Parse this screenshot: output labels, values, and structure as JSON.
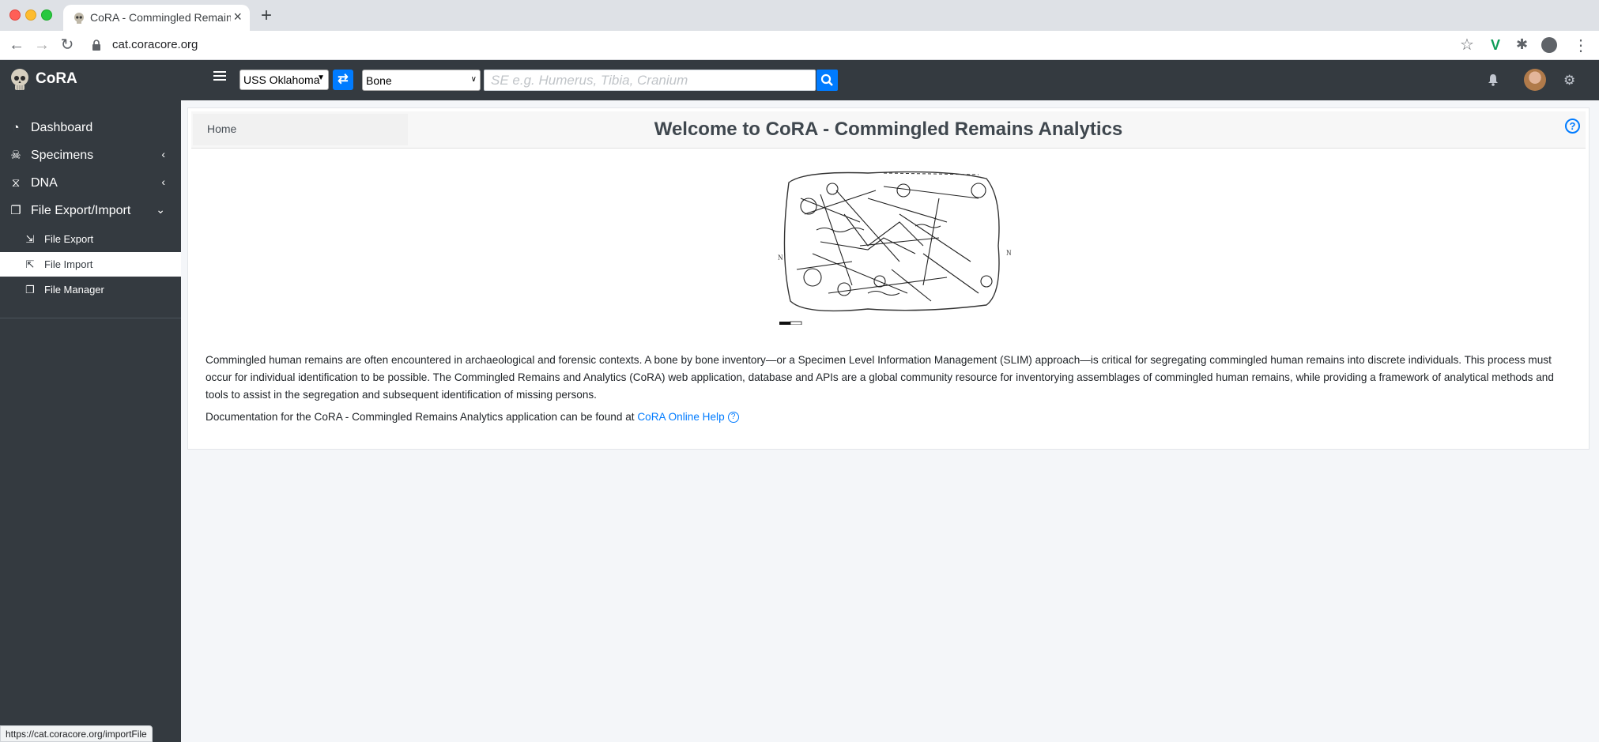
{
  "browser": {
    "tab_title": "CoRA - Commingled Remains /",
    "url": "cat.coracore.org",
    "status_url": "https://cat.coracore.org/importFile"
  },
  "navbar": {
    "brand": "CoRA",
    "project_select": "USS Oklahoma",
    "bone_select": "Bone",
    "search_placeholder": "SE e.g. Humerus, Tibia, Cranium"
  },
  "sidebar": {
    "items": [
      {
        "label": "Dashboard",
        "icon": "tachometer-icon"
      },
      {
        "label": "Specimens",
        "icon": "skull-icon"
      },
      {
        "label": "DNA",
        "icon": "dna-icon"
      },
      {
        "label": "File Export/Import",
        "icon": "copy-icon"
      }
    ],
    "subitems": [
      {
        "label": "File Export",
        "icon": "file-export-icon"
      },
      {
        "label": "File Import",
        "icon": "file-import-icon",
        "active": true
      },
      {
        "label": "File Manager",
        "icon": "copy-icon"
      }
    ]
  },
  "main": {
    "breadcrumb": "Home",
    "title": "Welcome to CoRA - Commingled Remains Analytics",
    "paragraph1": "Commingled human remains are often encountered in archaeological and forensic contexts. A bone by bone inventory—or a Specimen Level Information Management (SLIM) approach—is critical for segregating commingled human remains into discrete individuals. This process must occur for individual identification to be possible. The Commingled Remains and Analytics (CoRA) web application, database and APIs are a global community resource for inventorying assemblages of commingled human remains, while providing a framework of analytical methods and tools to assist in the segregation and subsequent identification of missing persons.",
    "paragraph2_prefix": "Documentation for the CoRA - Commingled Remains Analytics application can be found at",
    "help_link": "CoRA Online Help"
  },
  "colors": {
    "navbar": "#343a40",
    "accent": "#007bff",
    "background": "#f4f6f9"
  }
}
